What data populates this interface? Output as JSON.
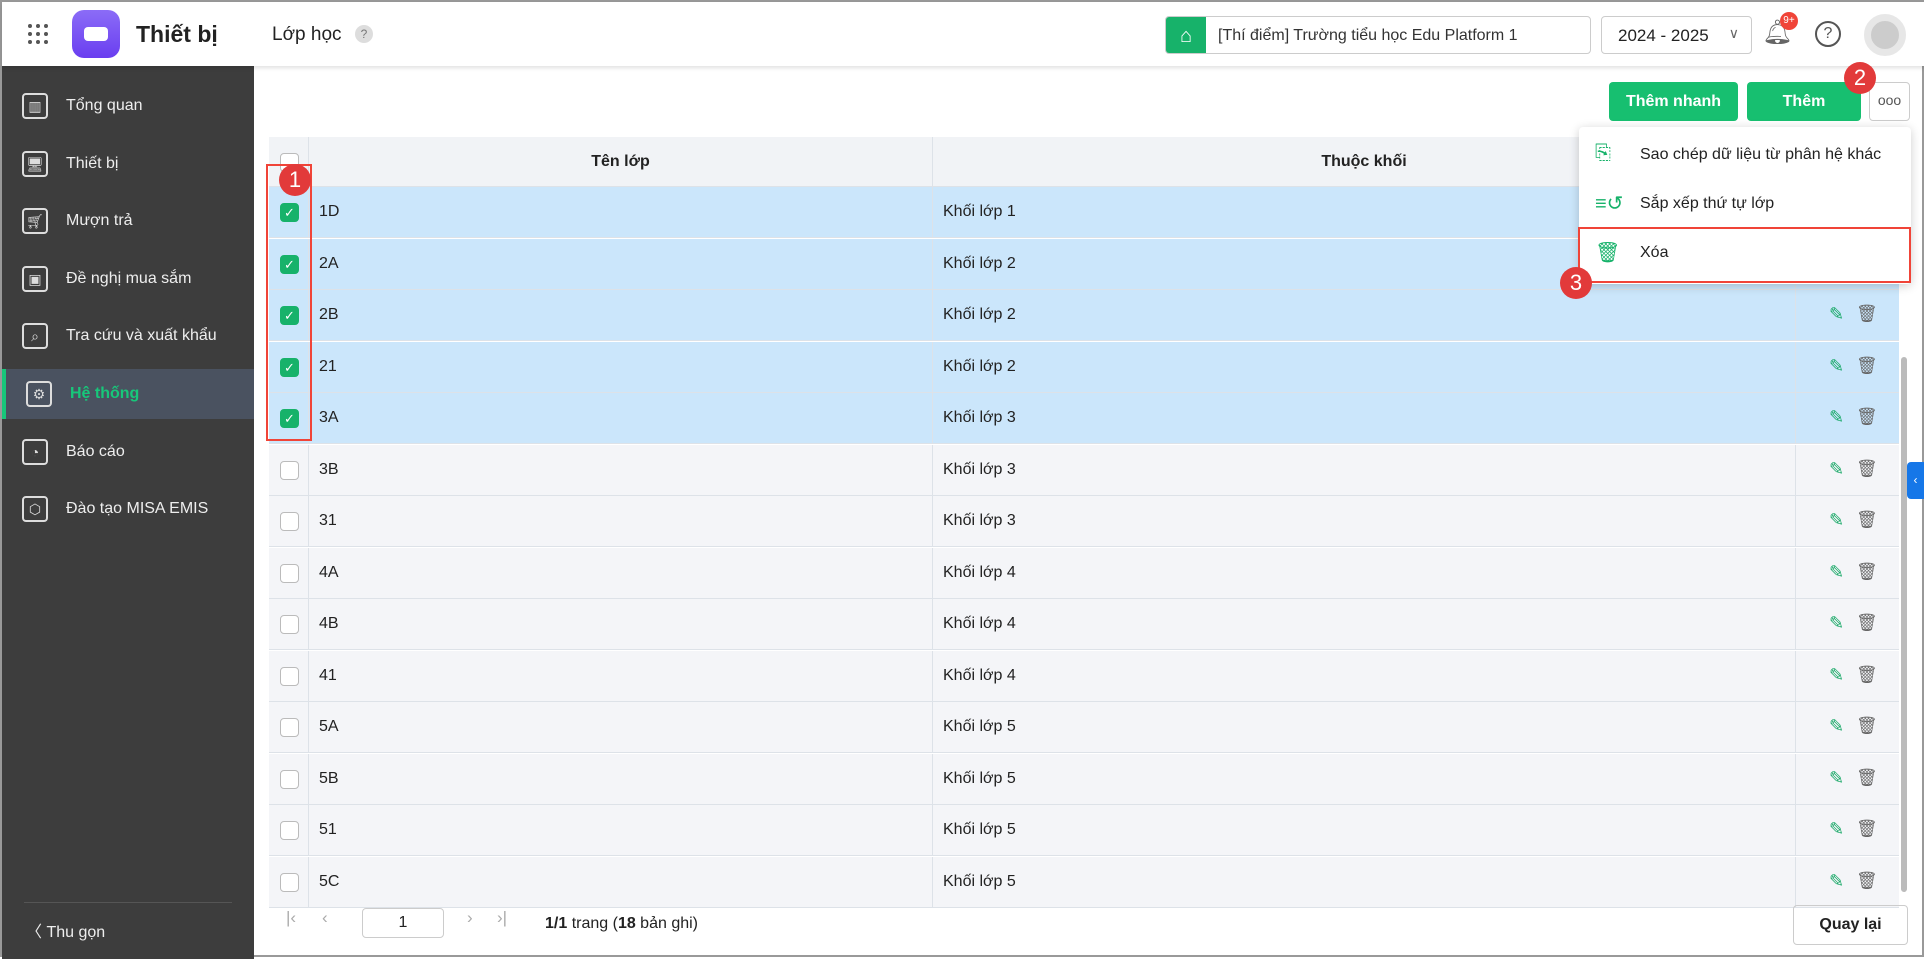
{
  "header": {
    "app_title": "Thiết bị",
    "page_title": "Lớp học",
    "help_mark": "?",
    "school": "[Thí điểm] Trường tiểu học Edu Platform 1",
    "year": "2024 - 2025",
    "notif_badge": "9+"
  },
  "sidebar": {
    "items": [
      {
        "label": "Tổng quan"
      },
      {
        "label": "Thiết bị"
      },
      {
        "label": "Mượn trả"
      },
      {
        "label": "Đề nghị mua sắm"
      },
      {
        "label": "Tra cứu và xuất khẩu"
      },
      {
        "label": "Hệ thống",
        "active": true
      },
      {
        "label": "Báo cáo"
      },
      {
        "label": "Đào tạo MISA EMIS"
      }
    ],
    "collapse": "Thu gọn"
  },
  "toolbar": {
    "quick_add": "Thêm nhanh",
    "add": "Thêm",
    "more": "ooo"
  },
  "menu": {
    "items": [
      {
        "label": "Sao chép dữ liệu từ phân hệ khác"
      },
      {
        "label": "Sắp xếp thứ tự lớp"
      },
      {
        "label": "Xóa"
      }
    ]
  },
  "table": {
    "headers": [
      "Tên lớp",
      "Thuộc khối"
    ],
    "rows": [
      {
        "name": "1D",
        "grade": "Khối lớp 1",
        "checked": true
      },
      {
        "name": "2A",
        "grade": "Khối lớp 2",
        "checked": true
      },
      {
        "name": "2B",
        "grade": "Khối lớp 2",
        "checked": true
      },
      {
        "name": "21",
        "grade": "Khối lớp 2",
        "checked": true
      },
      {
        "name": "3A",
        "grade": "Khối lớp 3",
        "checked": true
      },
      {
        "name": "3B",
        "grade": "Khối lớp 3",
        "checked": false
      },
      {
        "name": "31",
        "grade": "Khối lớp 3",
        "checked": false
      },
      {
        "name": "4A",
        "grade": "Khối lớp 4",
        "checked": false
      },
      {
        "name": "4B",
        "grade": "Khối lớp 4",
        "checked": false
      },
      {
        "name": "41",
        "grade": "Khối lớp 4",
        "checked": false
      },
      {
        "name": "5A",
        "grade": "Khối lớp 5",
        "checked": false
      },
      {
        "name": "5B",
        "grade": "Khối lớp 5",
        "checked": false
      },
      {
        "name": "51",
        "grade": "Khối lớp 5",
        "checked": false
      },
      {
        "name": "5C",
        "grade": "Khối lớp 5",
        "checked": false
      }
    ]
  },
  "pagination": {
    "page": "1",
    "pages": "1/1",
    "trang": " trang (",
    "records": "18",
    "suffix": " bản ghi)"
  },
  "footer": {
    "back": "Quay lại"
  },
  "annotations": [
    "1",
    "2",
    "3"
  ],
  "colors": {
    "accent": "#17b26a",
    "sidebar": "#3d3d3d",
    "selected_row": "#cbe6fb",
    "annotation": "#e23a3a"
  }
}
